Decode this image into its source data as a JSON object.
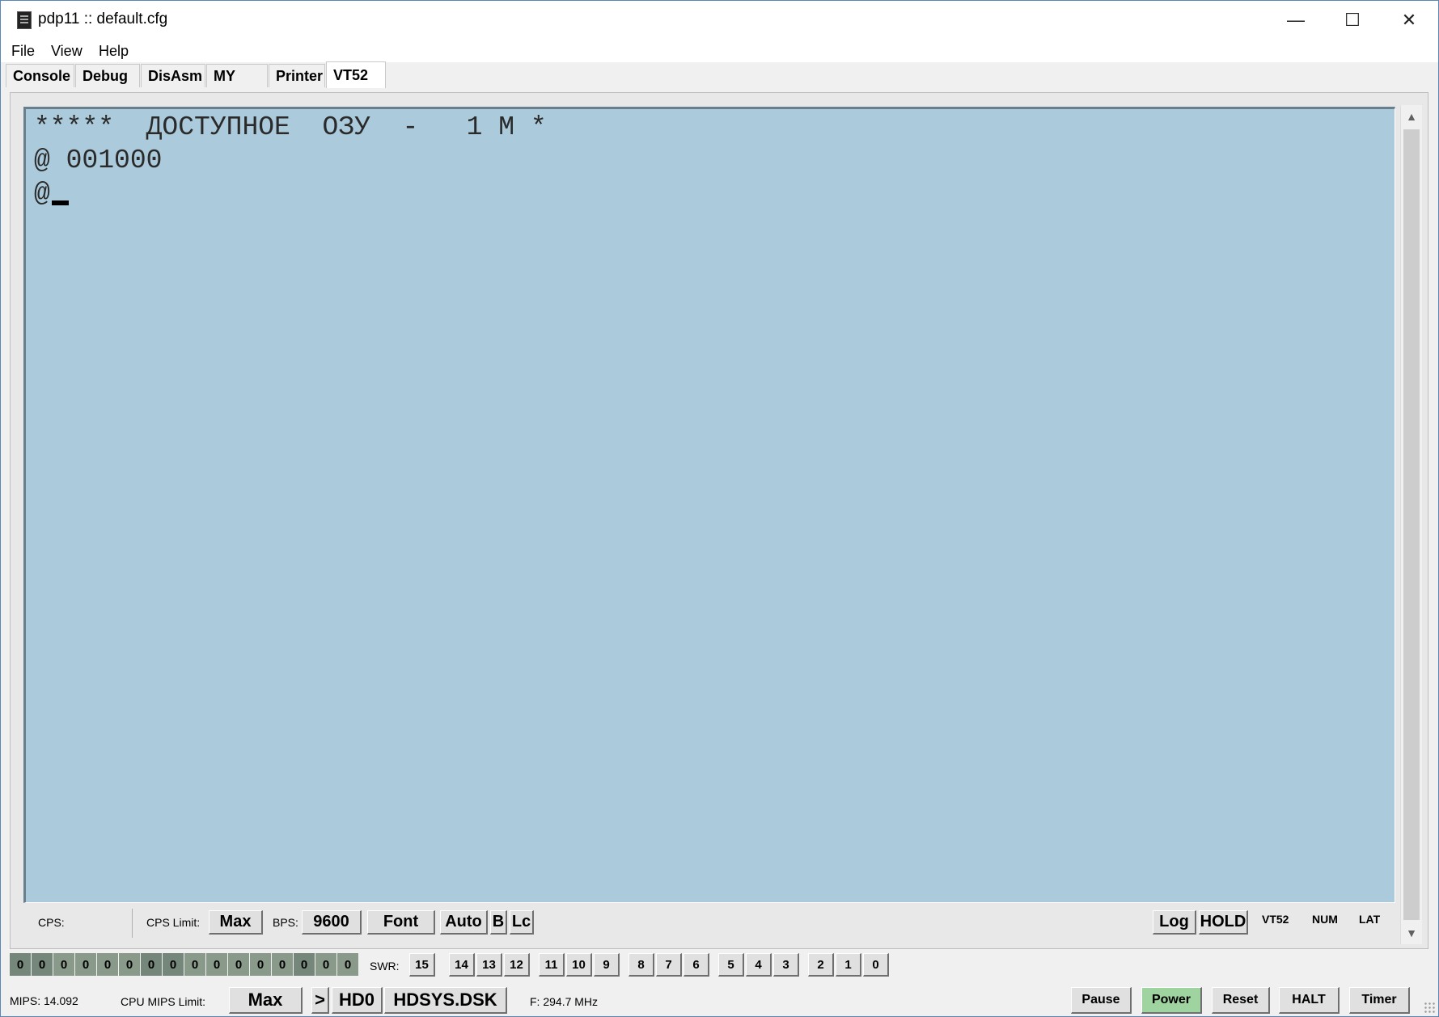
{
  "window": {
    "title": "pdp11 :: default.cfg",
    "controls": {
      "minimize": "—",
      "maximize": "☐",
      "close": "✕"
    }
  },
  "menu": [
    "File",
    "View",
    "Help"
  ],
  "tabs": [
    {
      "label": "Console",
      "active": false
    },
    {
      "label": "Debug",
      "active": false
    },
    {
      "label": "DisAsm",
      "active": false
    },
    {
      "label": "MY",
      "active": false
    },
    {
      "label": "Printer",
      "active": false
    },
    {
      "label": "VT52",
      "active": true
    }
  ],
  "terminal": {
    "background": "#abcbdc",
    "lines": [
      "*****  ДОСТУПНОЕ  ОЗУ  -   1 М *",
      "@ 001000",
      "@"
    ]
  },
  "terminal_status": {
    "cps_label": "CPS:",
    "cps_limit_label": "CPS Limit:",
    "cps_limit_value": "Max",
    "bps_label": "BPS:",
    "bps_value": "9600",
    "font_btn": "Font",
    "auto_btn": "Auto",
    "b_btn": "B",
    "lc_btn": "Lc",
    "log_btn": "Log",
    "hold_btn": "HOLD",
    "indicators": [
      "VT52",
      "NUM",
      "LAT"
    ]
  },
  "leds": [
    "0",
    "0",
    "0",
    "0",
    "0",
    "0",
    "0",
    "0",
    "0",
    "0",
    "0",
    "0",
    "0",
    "0",
    "0",
    "0"
  ],
  "swr": {
    "label": "SWR:",
    "switches": [
      "15",
      "14",
      "13",
      "12",
      "11",
      "10",
      "9",
      "8",
      "7",
      "6",
      "5",
      "4",
      "3",
      "2",
      "1",
      "0"
    ]
  },
  "bottom": {
    "mips": "MIPS: 14.092",
    "cpu_mips_limit_label": "CPU MIPS Limit:",
    "cpu_mips_limit_value": "Max",
    "arrow_btn": ">",
    "drive_btn": "HD0",
    "disk_btn": "HDSYS.DSK",
    "freq": "F: 294.7 MHz",
    "pause": "Pause",
    "power": "Power",
    "reset": "Reset",
    "halt": "HALT",
    "timer": "Timer"
  },
  "colors": {
    "power_active": "#9fd39f"
  }
}
